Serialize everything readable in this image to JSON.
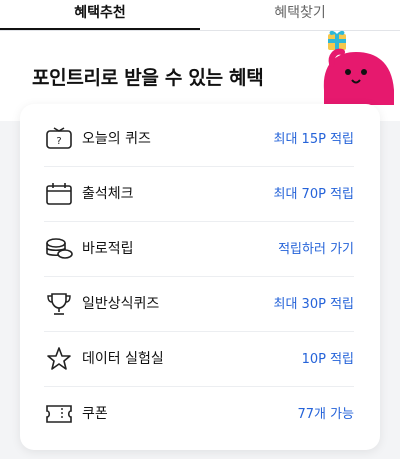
{
  "tabs": {
    "active": "혜택추천",
    "inactive": "혜택찾기"
  },
  "page": {
    "title": "포인트리로 받을 수 있는 혜택"
  },
  "benefits": [
    {
      "icon": "quiz-tv-icon",
      "label": "오늘의 퀴즈",
      "action": "최대 15P 적립"
    },
    {
      "icon": "calendar-icon",
      "label": "출석체크",
      "action": "최대 70P 적립"
    },
    {
      "icon": "coins-icon",
      "label": "바로적립",
      "action": "적립하러 가기"
    },
    {
      "icon": "trophy-icon",
      "label": "일반상식퀴즈",
      "action": "최대 30P 적립"
    },
    {
      "icon": "star-icon",
      "label": "데이터 실험실",
      "action": "10P 적립"
    },
    {
      "icon": "coupon-icon",
      "label": "쿠폰",
      "action": "77개 가능"
    }
  ],
  "colors": {
    "accent": "#2563d9",
    "mascot": "#e6196e"
  }
}
